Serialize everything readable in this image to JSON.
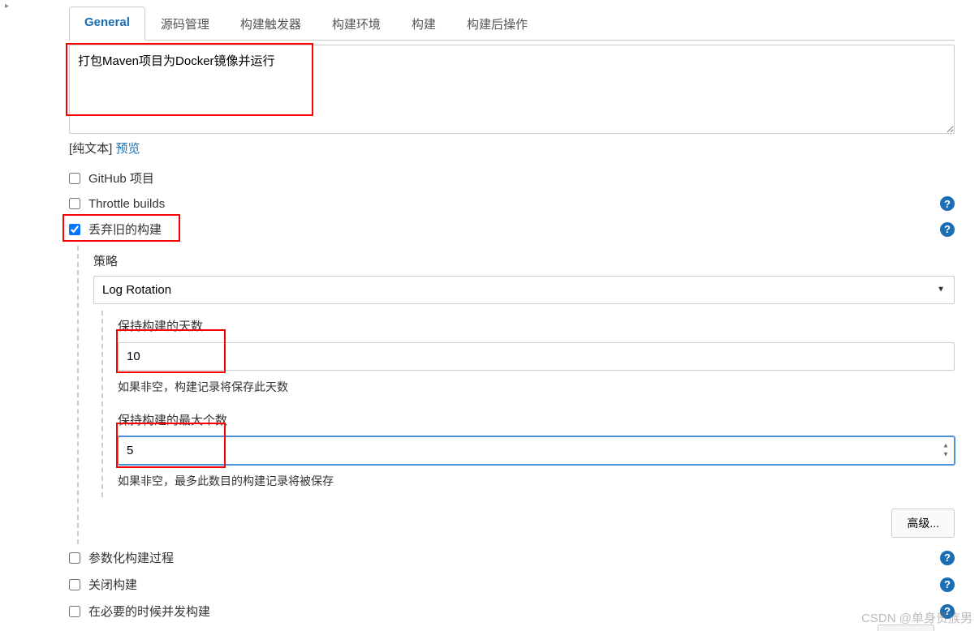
{
  "tabs": {
    "general": "General",
    "scm": "源码管理",
    "triggers": "构建触发器",
    "env": "构建环境",
    "build": "构建",
    "post": "构建后操作"
  },
  "description": {
    "value": "打包Maven项目为Docker镜像并运行",
    "plain_text_label": "[纯文本]",
    "preview_label": "预览"
  },
  "options": {
    "github_project": "GitHub 项目",
    "throttle_builds": "Throttle builds",
    "discard_old": "丢弃旧的构建",
    "parameterized": "参数化构建过程",
    "disable_build": "关闭构建",
    "concurrent": "在必要的时候并发构建"
  },
  "discard": {
    "strategy_label": "策略",
    "strategy_value": "Log Rotation",
    "days_label": "保持构建的天数",
    "days_value": "10",
    "days_hint": "如果非空，构建记录将保存此天数",
    "max_label": "保持构建的最大个数",
    "max_value": "5",
    "max_hint": "如果非空，最多此数目的构建记录将被保存",
    "advanced_label": "高级..."
  },
  "watermark": "CSDN @单身贵族男"
}
